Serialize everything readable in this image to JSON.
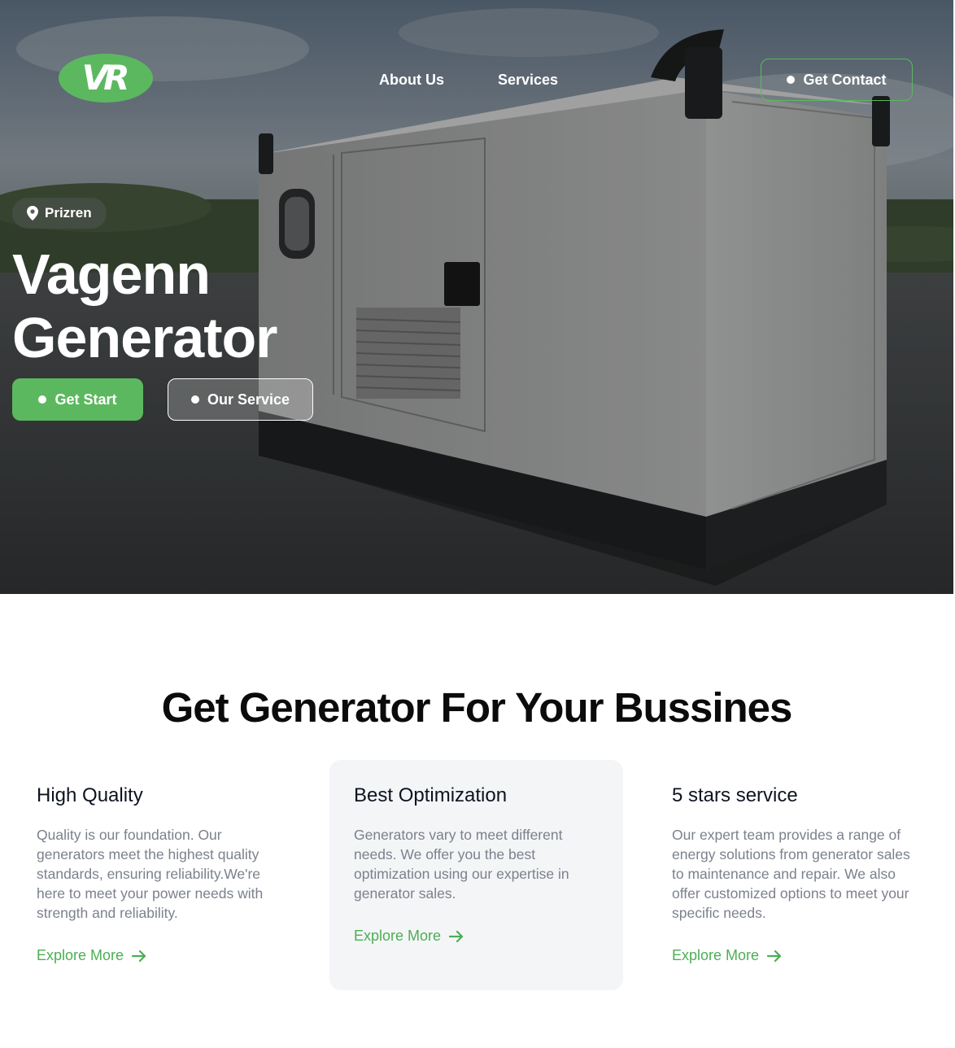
{
  "brand": {
    "logo_text": "VR",
    "accent_color": "#5cb85f"
  },
  "nav": {
    "about_label": "About Us",
    "services_label": "Services",
    "contact_label": "Get Contact"
  },
  "hero": {
    "location": "Prizren",
    "location_icon": "map-pin-icon",
    "title_line1": "Vagenn",
    "title_line2": "Generator",
    "start_label": "Get Start",
    "service_label": "Our Service"
  },
  "features": {
    "heading": "Get Generator For Your Bussines",
    "cards": [
      {
        "title": "High Quality",
        "body": "Quality is our foundation. Our generators meet the highest quality standards, ensuring reliability.We're here to meet your power needs with strength and reliability.",
        "link": "Explore More"
      },
      {
        "title": "Best Optimization",
        "body": "Generators vary to meet different needs. We offer you the best optimization using our expertise in generator sales.",
        "link": "Explore More"
      },
      {
        "title": "5 stars service",
        "body": "Our expert team provides a range of energy solutions from generator sales to maintenance and repair. We also offer customized options to meet your specific needs.",
        "link": "Explore More"
      }
    ]
  }
}
